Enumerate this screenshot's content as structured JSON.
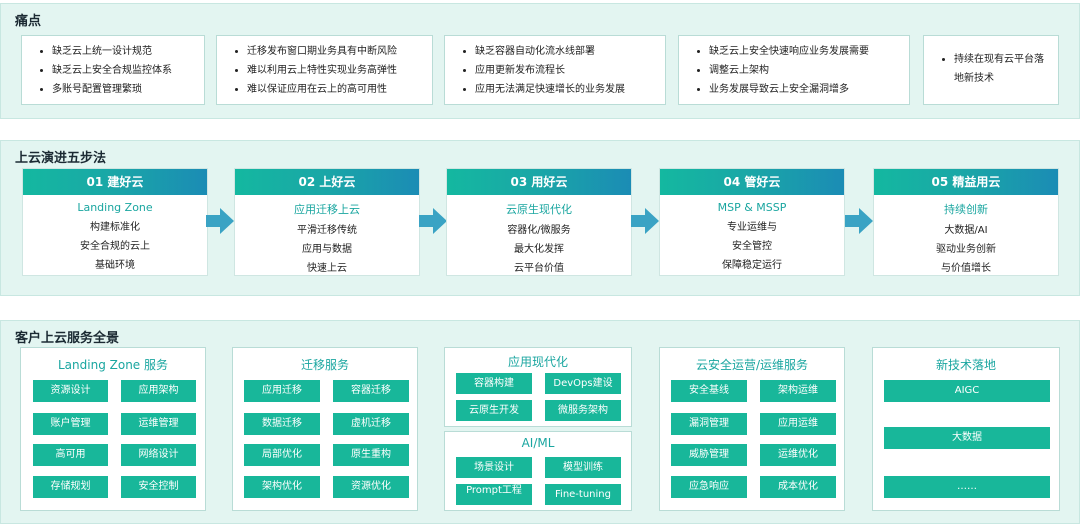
{
  "pain_points": {
    "title": "痛点",
    "groups": [
      [
        "缺乏云上统一设计规范",
        "缺乏云上安全合规监控体系",
        "多账号配置管理繁琐"
      ],
      [
        "迁移发布窗口期业务具有中断风险",
        "难以利用云上特性实现业务高弹性",
        "难以保证应用在云上的高可用性"
      ],
      [
        "缺乏容器自动化流水线部署",
        "应用更新发布流程长",
        "应用无法满足快速增长的业务发展"
      ],
      [
        "缺乏云上安全快速响应业务发展需要",
        "调整云上架构",
        "业务发展导致云上安全漏洞增多"
      ],
      [
        "持续在现有云平台落",
        "地新技术"
      ]
    ]
  },
  "steps": {
    "title": "上云演进五步法",
    "items": [
      {
        "head": "01  建好云",
        "sub": "Landing Zone",
        "lines": [
          "构建标准化",
          "安全合规的云上",
          "基础环境"
        ]
      },
      {
        "head": "02  上好云",
        "sub": "应用迁移上云",
        "lines": [
          "平滑迁移传统",
          "应用与数据",
          "快速上云"
        ]
      },
      {
        "head": "03  用好云",
        "sub": "云原生现代化",
        "lines": [
          "容器化/微服务",
          "最大化发挥",
          "云平台价值"
        ]
      },
      {
        "head": "04  管好云",
        "sub": "MSP & MSSP",
        "lines": [
          "专业运维与",
          "安全管控",
          "保障稳定运行"
        ]
      },
      {
        "head": "05  精益用云",
        "sub": "持续创新",
        "lines": [
          "大数据/AI",
          "驱动业务创新",
          "与价值增长"
        ]
      }
    ]
  },
  "services": {
    "title": "客户上云服务全景",
    "landing_zone": {
      "title": "Landing Zone 服务",
      "tags": [
        "资源设计",
        "应用架构",
        "账户管理",
        "运维管理",
        "高可用",
        "网络设计",
        "存储规划",
        "安全控制"
      ]
    },
    "migration": {
      "title": "迁移服务",
      "tags": [
        "应用迁移",
        "容器迁移",
        "数据迁移",
        "虚机迁移",
        "局部优化",
        "原生重构",
        "架构优化",
        "资源优化"
      ]
    },
    "app_modern": {
      "title": "应用现代化",
      "tags": [
        "容器构建",
        "DevOps建设",
        "云原生开发",
        "微服务架构"
      ]
    },
    "aiml": {
      "title": "AI/ML",
      "tags": [
        "场景设计",
        "模型训练",
        "Prompt工程",
        "Fine-tuning"
      ]
    },
    "secops": {
      "title": "云安全运营/运维服务",
      "tags": [
        "安全基线",
        "架构运维",
        "漏洞管理",
        "应用运维",
        "威胁管理",
        "运维优化",
        "应急响应",
        "成本优化"
      ]
    },
    "newtech": {
      "title": "新技术落地",
      "tags": [
        "AIGC",
        "大数据",
        "……"
      ]
    }
  },
  "colors": {
    "accent": "#18b79a",
    "arrow": "#3aa3c4",
    "section_bg": "#e3f5f1"
  }
}
